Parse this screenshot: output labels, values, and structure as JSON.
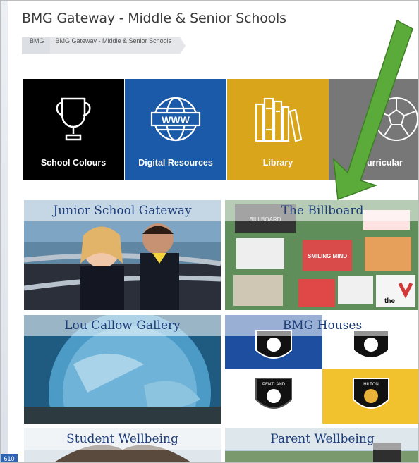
{
  "page": {
    "title": "BMG Gateway - Middle & Senior Schools",
    "page_number": "610"
  },
  "breadcrumb": [
    "BMG",
    "BMG Gateway - Middle & Senior Schools"
  ],
  "quick_links": [
    {
      "label": "School Colours",
      "icon": "trophy-icon",
      "color": "#000000"
    },
    {
      "label": "Digital Resources",
      "icon": "globe-www-icon",
      "color": "#1a5aa8"
    },
    {
      "label": "Library",
      "icon": "books-icon",
      "color": "#d9a51a"
    },
    {
      "label": "Curricular",
      "icon": "soccer-ball-icon",
      "color": "#777777"
    }
  ],
  "cards": [
    {
      "title": "Junior School Gateway"
    },
    {
      "title": "The Billboard"
    },
    {
      "title": "Lou Callow Gallery"
    },
    {
      "title": "BMG Houses"
    },
    {
      "title": "Student Wellbeing"
    },
    {
      "title": "Parent Wellbeing"
    }
  ],
  "billboard_notes": [
    "BILLBOARD",
    "SMILING MIND",
    "the"
  ],
  "houses": [
    "PENTLAND",
    "HILTON"
  ],
  "annotation": {
    "arrow_color": "#5bab3a"
  }
}
